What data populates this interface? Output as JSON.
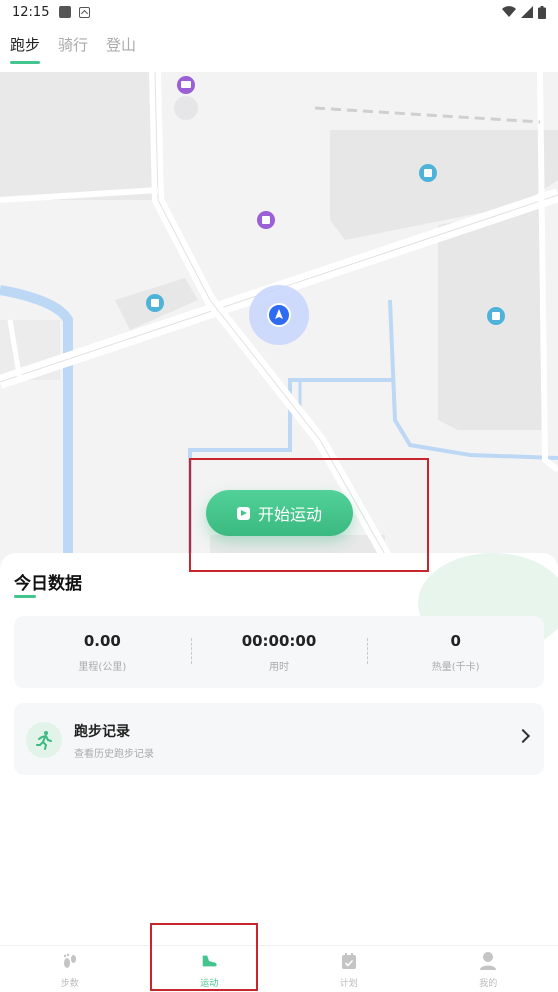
{
  "status_bar": {
    "time": "12:15"
  },
  "tabs": [
    {
      "label": "跑步",
      "active": true
    },
    {
      "label": "骑行",
      "active": false
    },
    {
      "label": "登山",
      "active": false
    }
  ],
  "map": {
    "start_button_label": "开始运动"
  },
  "today": {
    "title": "今日数据",
    "stats": [
      {
        "value": "0.00",
        "label": "里程(公里)"
      },
      {
        "value": "00:00:00",
        "label": "用时"
      },
      {
        "value": "0",
        "label": "热量(千卡)"
      }
    ]
  },
  "record": {
    "title": "跑步记录",
    "subtitle": "查看历史跑步记录"
  },
  "bottom_nav": [
    {
      "label": "步数",
      "icon": "footprint-icon",
      "active": false
    },
    {
      "label": "运动",
      "icon": "shoe-icon",
      "active": true
    },
    {
      "label": "计划",
      "icon": "calendar-icon",
      "active": false
    },
    {
      "label": "我的",
      "icon": "person-icon",
      "active": false
    }
  ],
  "colors": {
    "accent": "#44c58e",
    "highlight": "#c8262c",
    "water": "#bcd8f5"
  }
}
